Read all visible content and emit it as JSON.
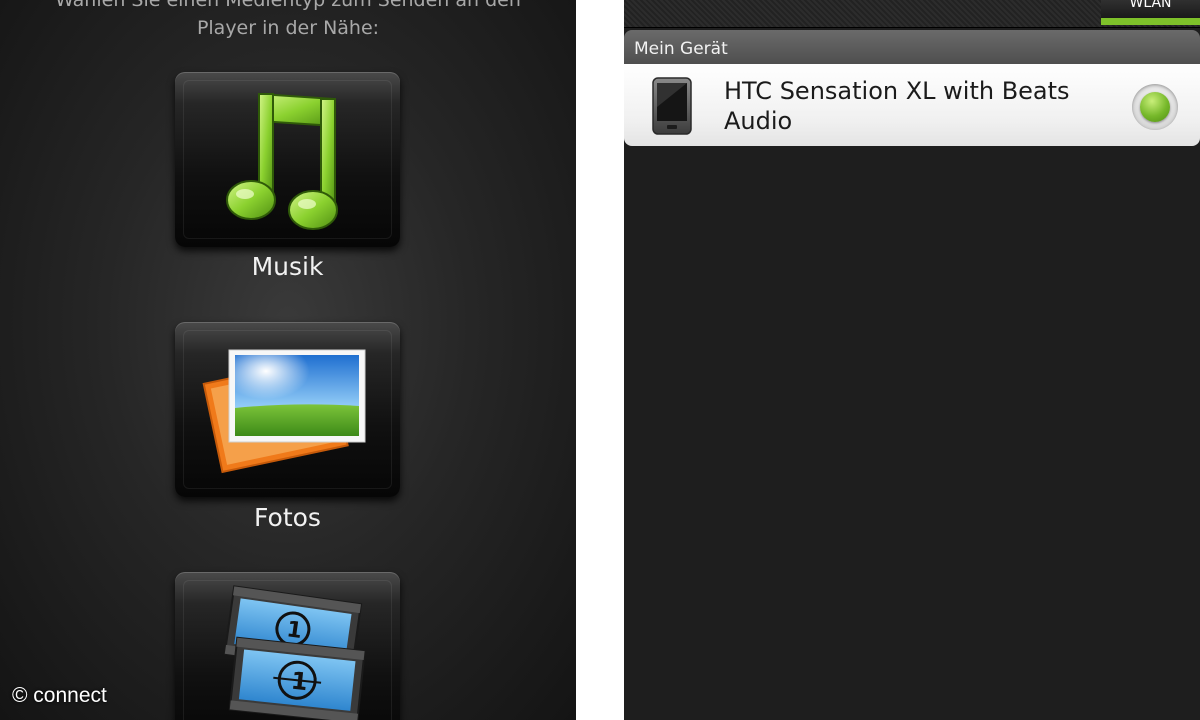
{
  "left_screen": {
    "instruction_line1": "Wählen Sie einen Medientyp zum Senden an den",
    "instruction_line2": "Player in der Nähe:",
    "tiles": [
      {
        "label": "Musik",
        "icon": "music-note-icon"
      },
      {
        "label": "Fotos",
        "icon": "photos-icon"
      },
      {
        "label": "",
        "icon": "video-film-icon"
      }
    ]
  },
  "right_screen": {
    "top_tab": "WLAN",
    "section_header": "Mein Gerät",
    "devices": [
      {
        "name": "HTC Sensation XL with Beats Audio",
        "selected": true,
        "icon": "phone-icon"
      }
    ]
  },
  "watermark": "© connect",
  "colors": {
    "accent_green": "#7ec12a",
    "background_dark": "#1e1e1e"
  }
}
